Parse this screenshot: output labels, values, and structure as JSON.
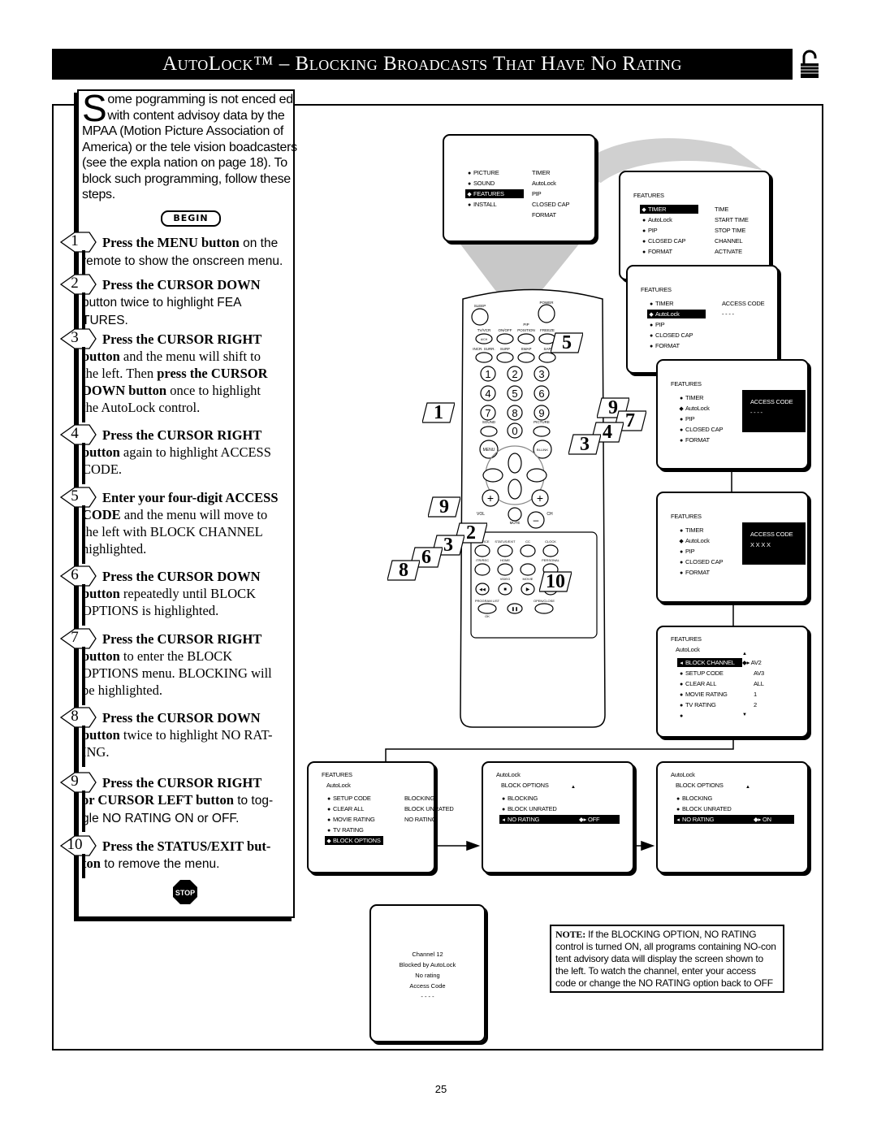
{
  "header": {
    "title": "AutoLock™ – Blocking Broadcasts That Have No Rating",
    "icon": "lock-icon"
  },
  "intro": {
    "drop_cap": "S",
    "text": "ome pogramming is not enced ed with content advisoy data by the MPAA (Motion Picture Association of America) or the tele vision boadcasters (see the expla nation on page 18). To block such programming, follow these steps."
  },
  "begin_label": "BEGIN",
  "steps": [
    {
      "num": "1",
      "lines": [
        [
          {
            "b": true,
            "t": "Press the MENU button"
          },
          {
            "b": false,
            "s": true,
            "t": " on the"
          }
        ],
        [
          {
            "b": false,
            "s": true,
            "t": "remote to show the onscreen menu."
          }
        ]
      ]
    },
    {
      "num": "2",
      "lines": [
        [
          {
            "b": true,
            "t": "Press the CURSOR DOWN"
          }
        ],
        [
          {
            "b": false,
            "s": true,
            "t": "button twice to highlight FEA"
          }
        ],
        [
          {
            "b": false,
            "s": true,
            "t": "TURES."
          }
        ]
      ]
    },
    {
      "num": "3",
      "lines": [
        [
          {
            "b": true,
            "t": "Press the CURSOR RIGHT"
          }
        ],
        [
          {
            "b": true,
            "t": "button"
          },
          {
            "b": false,
            "t": " and the menu will shift to"
          }
        ],
        [
          {
            "b": false,
            "t": "the left. Then "
          },
          {
            "b": true,
            "t": "press the CURSOR"
          }
        ],
        [
          {
            "b": true,
            "t": "DOWN button"
          },
          {
            "b": false,
            "t": " once to highlight"
          }
        ],
        [
          {
            "b": false,
            "t": "the AutoLock control."
          }
        ]
      ]
    },
    {
      "num": "4",
      "lines": [
        [
          {
            "b": true,
            "t": "Press the CURSOR RIGHT"
          }
        ],
        [
          {
            "b": true,
            "t": "button"
          },
          {
            "b": false,
            "t": " again to highlight ACCESS"
          }
        ],
        [
          {
            "b": false,
            "t": "CODE."
          }
        ]
      ]
    },
    {
      "num": "5",
      "lines": [
        [
          {
            "b": true,
            "t": "Enter your four-digit ACCESS"
          }
        ],
        [
          {
            "b": true,
            "t": "CODE"
          },
          {
            "b": false,
            "t": " and the menu will move to"
          }
        ],
        [
          {
            "b": false,
            "t": "the left with BLOCK CHANNEL"
          }
        ],
        [
          {
            "b": false,
            "t": "highlighted."
          }
        ]
      ]
    },
    {
      "num": "6",
      "lines": [
        [
          {
            "b": true,
            "t": "Press the CURSOR DOWN"
          }
        ],
        [
          {
            "b": true,
            "t": "button"
          },
          {
            "b": false,
            "t": " repeatedly until BLOCK"
          }
        ],
        [
          {
            "b": false,
            "t": "OPTIONS is highlighted."
          }
        ]
      ]
    },
    {
      "num": "7",
      "lines": [
        [
          {
            "b": true,
            "t": "Press the CURSOR RIGHT"
          }
        ],
        [
          {
            "b": true,
            "t": "button"
          },
          {
            "b": false,
            "t": " to enter the BLOCK"
          }
        ],
        [
          {
            "b": false,
            "t": "OPTIONS menu. BLOCKING will"
          }
        ],
        [
          {
            "b": false,
            "t": "be highlighted."
          }
        ]
      ]
    },
    {
      "num": "8",
      "lines": [
        [
          {
            "b": true,
            "t": "Press the CURSOR DOWN"
          }
        ],
        [
          {
            "b": true,
            "t": "button"
          },
          {
            "b": false,
            "t": " twice to highlight NO RAT-"
          }
        ],
        [
          {
            "b": false,
            "t": "ING."
          }
        ]
      ]
    },
    {
      "num": "9",
      "lines": [
        [
          {
            "b": true,
            "t": " Press the CURSOR RIGHT"
          }
        ],
        [
          {
            "b": true,
            "t": "or CURSOR LEFT button"
          },
          {
            "b": false,
            "s": true,
            "t": " to tog-"
          }
        ],
        [
          {
            "b": false,
            "s": true,
            "t": "gle NO RATING ON or OFF."
          }
        ]
      ]
    },
    {
      "num": "10",
      "lines": [
        [
          {
            "b": true,
            "t": "Press the STATUS/EXIT but-"
          }
        ],
        [
          {
            "b": true,
            "t": "ton"
          },
          {
            "b": false,
            "s": true,
            "t": " to remove the menu."
          }
        ]
      ]
    }
  ],
  "stop_label": "STOP",
  "remote": {
    "sleep": "SLEEP",
    "power": "POWER",
    "pip": "PIP",
    "row1": [
      "TV/VCR",
      "ON/OFF",
      "POSITION",
      "FREEZE"
    ],
    "ach": "A/CH",
    "row2": [
      "INCR. SURR.",
      "SURF",
      "SWAP",
      "SAP"
    ],
    "digits": [
      "1",
      "2",
      "3",
      "4",
      "5",
      "6",
      "7",
      "8",
      "9",
      "0"
    ],
    "sound": "SOUND",
    "picture": "PICTURE",
    "menu": "MENU",
    "bilink": "BI-LINK",
    "vol": "VOL",
    "ch": "CH",
    "mute": "MUTE",
    "row3": [
      "SOURCE",
      "STATUS/EXIT",
      "CC",
      "CLOCK"
    ],
    "row4": [
      "ITR/REC",
      "HOME",
      "",
      "PERSONAL"
    ],
    "row5": [
      "VIDEO",
      "MOVIE"
    ],
    "program_list": "PROGRAM LIST",
    "open_close": "OPEN/CLOSE",
    "ok": "OK"
  },
  "callouts": [
    "1",
    "5",
    "9",
    "7",
    "4",
    "3",
    "9",
    "2",
    "3",
    "6",
    "8",
    "10"
  ],
  "screens": [
    {
      "id": "main-menu",
      "rows": [
        {
          "l": "PICTURE",
          "r": "TIMER",
          "mk": "bullet"
        },
        {
          "l": "SOUND",
          "r": "AutoLock",
          "mk": "bullet"
        },
        {
          "l": "FEATURES",
          "r": "PIP",
          "mk": "cursor",
          "hl": "left"
        },
        {
          "l": "INSTALL",
          "r": "CLOSED  CAP",
          "mk": "bullet"
        },
        {
          "l": "",
          "r": "FORMAT",
          "mk": ""
        }
      ]
    },
    {
      "id": "features-timer",
      "title": "FEATURES",
      "rows": [
        {
          "l": "TIMER",
          "r": "TIME",
          "mk": "cursor",
          "hl": "left"
        },
        {
          "l": "AutoLock",
          "r": "START  TIME",
          "mk": "bullet"
        },
        {
          "l": "PIP",
          "r": "STOP  TIME",
          "mk": "bullet"
        },
        {
          "l": "CLOSED  CAP",
          "r": "CHANNEL",
          "mk": "bullet"
        },
        {
          "l": "FORMAT",
          "r": "ACTIVATE",
          "mk": "bullet"
        }
      ]
    },
    {
      "id": "features-autolock",
      "title": "FEATURES",
      "rows": [
        {
          "l": "TIMER",
          "r": "ACCESS  CODE",
          "mk": "bullet"
        },
        {
          "l": "AutoLock",
          "r": "-  -  -  -",
          "mk": "cursor",
          "hl": "left"
        },
        {
          "l": "PIP",
          "r": "",
          "mk": "bullet"
        },
        {
          "l": "CLOSED  CAP",
          "r": "",
          "mk": "bullet"
        },
        {
          "l": "FORMAT",
          "r": "",
          "mk": "bullet"
        }
      ]
    },
    {
      "id": "access-code-empty",
      "title": "FEATURES",
      "box": [
        "ACCESS  CODE",
        "-  -  -  -"
      ],
      "rows": [
        {
          "l": "TIMER",
          "r": "",
          "mk": "bullet"
        },
        {
          "l": "AutoLock",
          "r": "",
          "mk": "cursor"
        },
        {
          "l": "PIP",
          "r": "",
          "mk": "bullet"
        },
        {
          "l": "CLOSED  CAP",
          "r": "",
          "mk": "bullet"
        },
        {
          "l": "FORMAT",
          "r": "",
          "mk": "bullet"
        }
      ]
    },
    {
      "id": "access-code-entered",
      "title": "FEATURES",
      "box": [
        "ACCESS  CODE",
        "X  X  X  X"
      ],
      "rows": [
        {
          "l": "TIMER",
          "r": "",
          "mk": "bullet"
        },
        {
          "l": "AutoLock",
          "r": "",
          "mk": "cursor"
        },
        {
          "l": "PIP",
          "r": "",
          "mk": "bullet"
        },
        {
          "l": "CLOSED  CAP",
          "r": "",
          "mk": "bullet"
        },
        {
          "l": "FORMAT",
          "r": "",
          "mk": "bullet"
        }
      ]
    },
    {
      "id": "block-channel",
      "title": "FEATURES",
      "subtitle": "AutoLock",
      "up": "▲",
      "down": "▼",
      "rows": [
        {
          "l": "BLOCK  CHANNEL",
          "r": "AV2",
          "mk": "left",
          "hl": "left",
          "rmk": "◆▸"
        },
        {
          "l": "SETUP  CODE",
          "r": "AV3",
          "mk": "bullet"
        },
        {
          "l": "CLEAR  ALL",
          "r": "ALL",
          "mk": "bullet"
        },
        {
          "l": "MOVIE  RATING",
          "r": "1",
          "mk": "bullet"
        },
        {
          "l": "TV  RATING",
          "r": "2",
          "mk": "bullet"
        },
        {
          "l": "",
          "r": "",
          "mk": "bullet"
        }
      ]
    },
    {
      "id": "block-options",
      "title": "FEATURES",
      "subtitle": "AutoLock",
      "rows": [
        {
          "l": "SETUP  CODE",
          "r": "BLOCKING",
          "mk": "bullet"
        },
        {
          "l": "CLEAR  ALL",
          "r": "BLOCK  UNRATED",
          "mk": "bullet"
        },
        {
          "l": "MOVIE  RATING",
          "r": "NO  RATING",
          "mk": "bullet"
        },
        {
          "l": "TV  RATING",
          "r": "",
          "mk": "bullet"
        },
        {
          "l": "BLOCK  OPTIONS",
          "r": "",
          "mk": "cursor",
          "hl": "left"
        }
      ]
    },
    {
      "id": "no-rating-off",
      "title": "AutoLock",
      "subtitle": "BLOCK  OPTIONS",
      "up": "▲",
      "rows": [
        {
          "l": "BLOCKING",
          "r": "",
          "mk": "bullet"
        },
        {
          "l": "BLOCK  UNRATED",
          "r": "",
          "mk": "bullet"
        },
        {
          "l": "NO  RATING",
          "r": "OFF",
          "mk": "left",
          "hl": "full",
          "rmk": "◆▸"
        }
      ]
    },
    {
      "id": "no-rating-on",
      "title": "AutoLock",
      "subtitle": "BLOCK  OPTIONS",
      "up": "▲",
      "rows": [
        {
          "l": "BLOCKING",
          "r": "",
          "mk": "bullet"
        },
        {
          "l": "BLOCK  UNRATED",
          "r": "",
          "mk": "bullet"
        },
        {
          "l": "NO  RATING",
          "r": "ON",
          "mk": "left",
          "hl": "full",
          "rmk": "◆▸"
        }
      ]
    }
  ],
  "blocked_screen": {
    "lines": [
      "Channel  12",
      "Blocked  by  AutoLock",
      "No  rating",
      "Access  Code",
      "-  -  -  -"
    ]
  },
  "note": {
    "label": "NOTE:",
    "text": " If the BLOCKING OPTION, NO RATING control is turned ON, all programs containing NO-con tent advisory data will display the screen shown to the left. To watch the channel, enter your access code or change the NO RATING option back to OFF"
  },
  "page_number": "25"
}
